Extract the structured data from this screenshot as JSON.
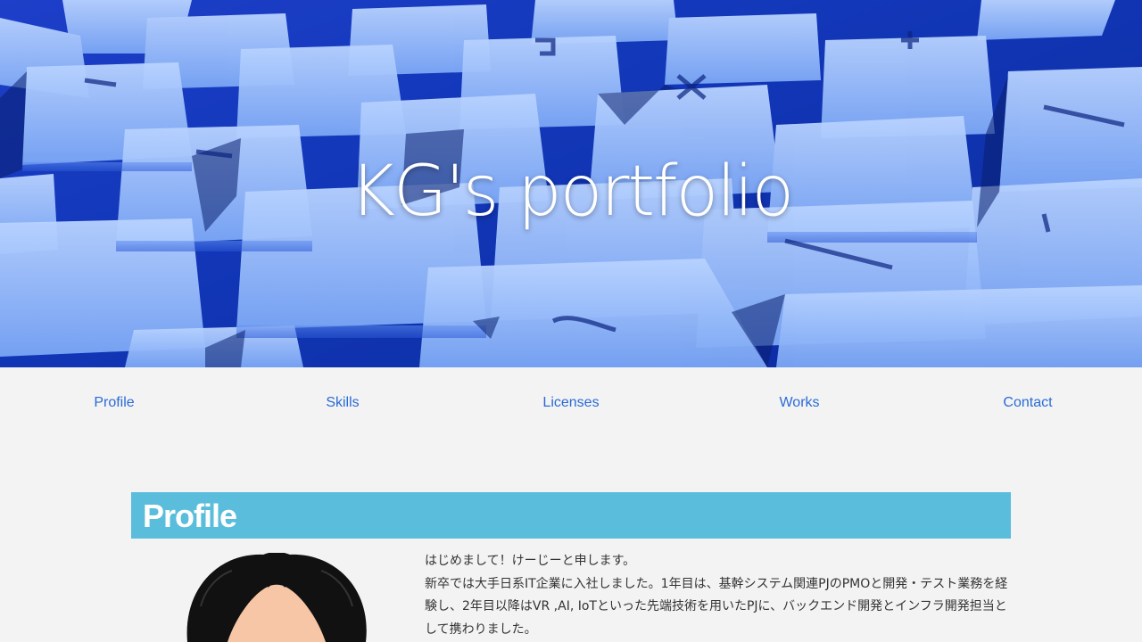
{
  "hero": {
    "title": "KG's portfolio"
  },
  "nav": {
    "items": [
      {
        "label": "Profile"
      },
      {
        "label": "Skills"
      },
      {
        "label": "Licenses"
      },
      {
        "label": "Works"
      },
      {
        "label": "Contact"
      }
    ]
  },
  "profile": {
    "heading": "Profile",
    "paragraphs": [
      "はじめまして！けーじーと申します。",
      "新卒では大手日系IT企業に入社しました。1年目は、基幹システム関連PJのPMOと開発・テスト業務を経験し、2年目以降はVR ,AI, IoTといった先端技術を用いたPJに、バックエンド開発とインフラ開発担当として携わりました。"
    ]
  },
  "colors": {
    "nav_link": "#2a6bd6",
    "section_bar": "#59bddb",
    "background": "#f3f3f3",
    "hero_blue": "#1d3fc9"
  }
}
